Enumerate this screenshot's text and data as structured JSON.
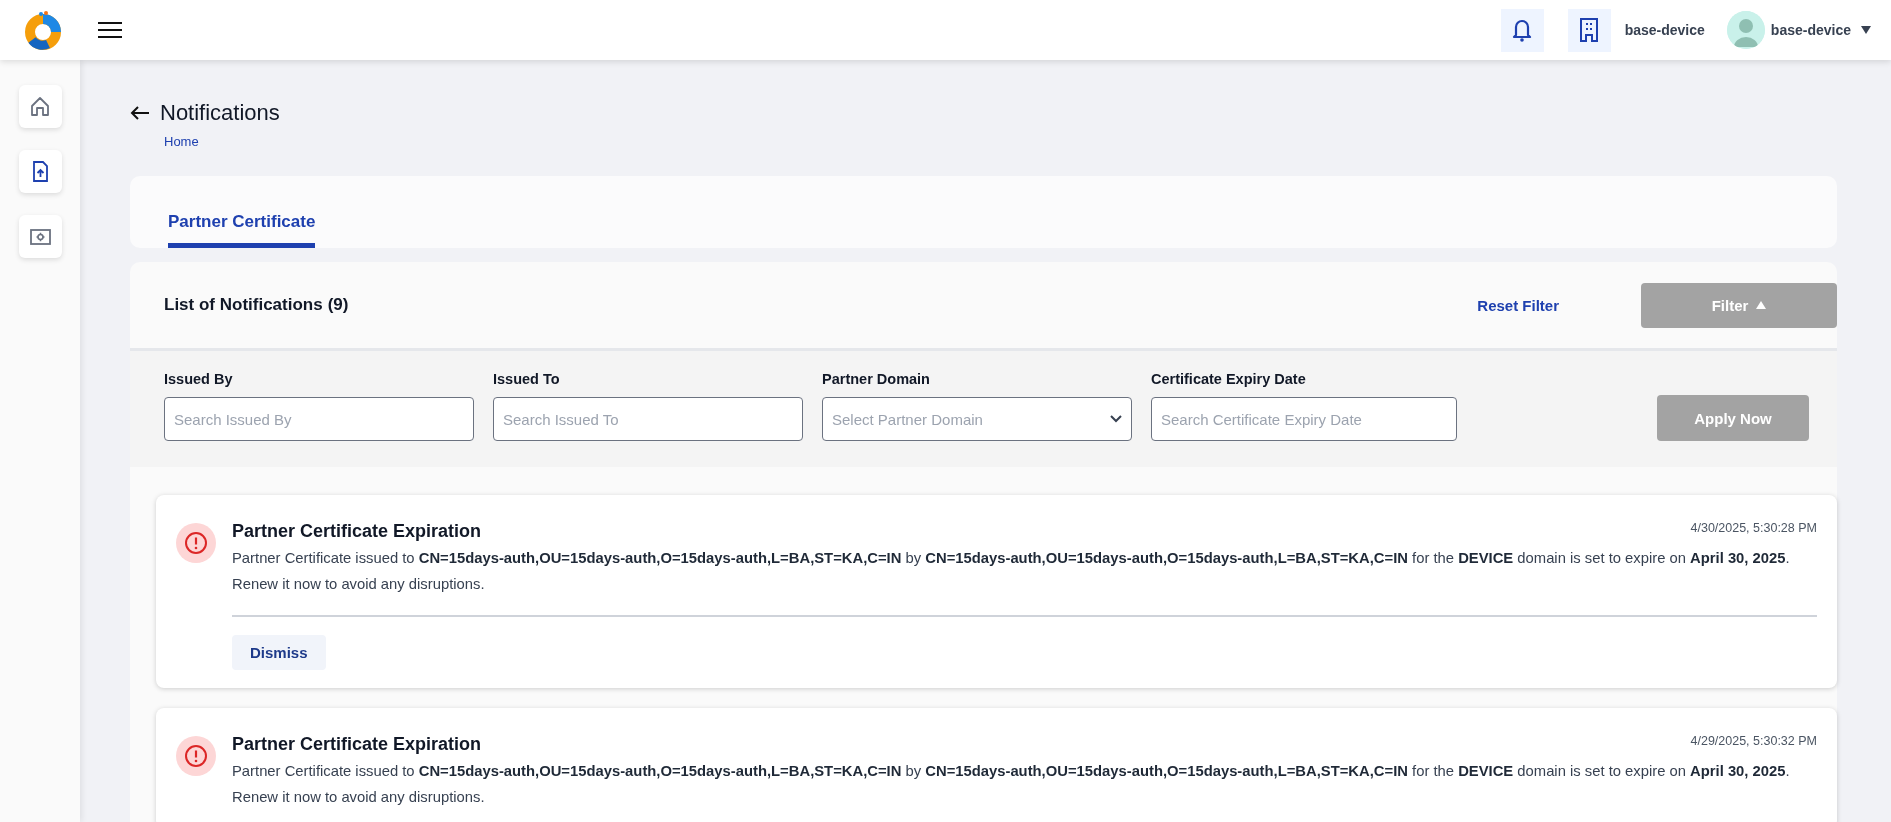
{
  "header": {
    "org": "base-device",
    "user": "base-device"
  },
  "sidebar": {
    "items": [
      {
        "kind": "home",
        "selected": false
      },
      {
        "kind": "upload",
        "selected": true
      },
      {
        "kind": "settings",
        "selected": false
      }
    ]
  },
  "page": {
    "title": "Notifications",
    "breadcrumb": "Home"
  },
  "tabs": [
    {
      "label": "Partner Certificate",
      "selected": true
    }
  ],
  "list": {
    "title": "List of Notifications",
    "count": "(9)",
    "reset": "Reset Filter",
    "filter_button": {
      "label": "Filter",
      "expanded": true
    }
  },
  "filters": [
    {
      "kind": "text",
      "label": "Issued By",
      "placeholder": "Search Issued By"
    },
    {
      "kind": "text",
      "label": "Issued To",
      "placeholder": "Search Issued To"
    },
    {
      "kind": "select",
      "label": "Partner Domain",
      "placeholder": "Select Partner Domain"
    },
    {
      "kind": "text",
      "label": "Certificate Expiry Date",
      "placeholder": "Search Certificate Expiry Date"
    }
  ],
  "apply_button": {
    "label": "Apply Now",
    "disabled": true
  },
  "notifications": [
    {
      "title": "Partner Certificate Expiration",
      "time": "4/30/2025, 5:30:28 PM",
      "message": "Partner Certificate issued to **CN=15days-auth,OU=15days-auth,O=15days-auth,L=BA,ST=KA,C=IN** by **CN=15days-auth,OU=15days-auth,O=15days-auth,L=BA,ST=KA,C=IN** for the **DEVICE** domain is set to expire on **April 30, 2025**. Renew it now to avoid any disruptions.",
      "action": "Dismiss"
    },
    {
      "title": "Partner Certificate Expiration",
      "time": "4/29/2025, 5:30:32 PM",
      "message": "Partner Certificate issued to **CN=15days-auth,OU=15days-auth,O=15days-auth,L=BA,ST=KA,C=IN** by **CN=15days-auth,OU=15days-auth,O=15days-auth,L=BA,ST=KA,C=IN** for the **DEVICE** domain is set to expire on **April 30, 2025**. Renew it now to avoid any disruptions."
    }
  ]
}
